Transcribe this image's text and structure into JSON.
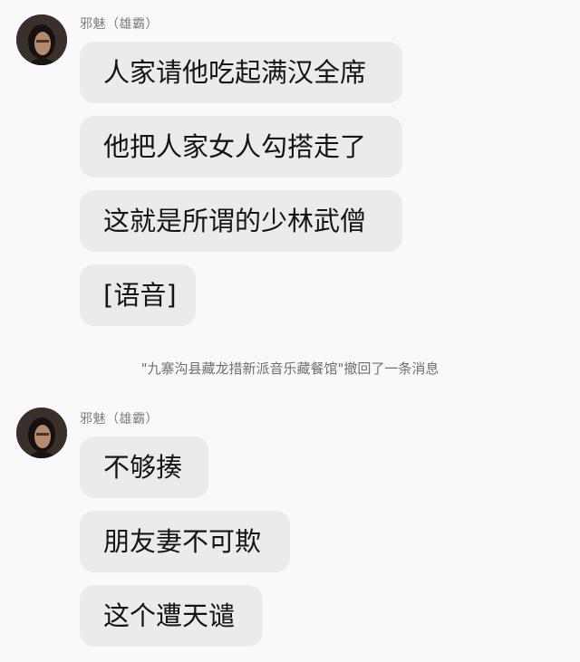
{
  "groups": [
    {
      "sender": "邪魅（雄霸）",
      "messages": [
        "人家请他吃起满汉全席",
        "他把人家女人勾搭走了",
        "这就是所谓的少林武僧",
        "[语音]"
      ]
    },
    {
      "sender": "邪魅（雄霸）",
      "messages": [
        "不够揍",
        "朋友妻不可欺",
        "这个遭天谴"
      ]
    }
  ],
  "system_notice": "\"九寨沟县藏龙措新派音乐藏餐馆\"撤回了一条消息",
  "icons": {
    "avatar": "user-avatar-photo"
  }
}
